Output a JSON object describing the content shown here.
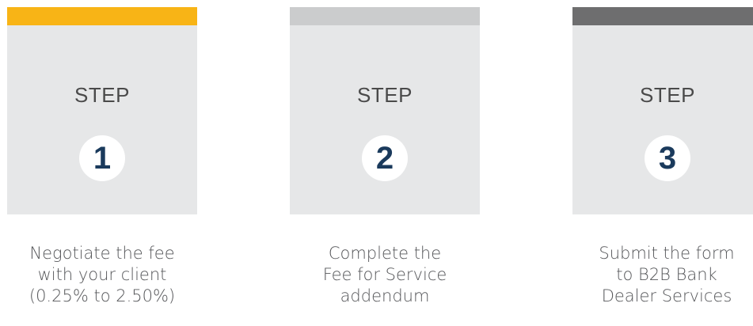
{
  "colors": {
    "card_background": "#e6e7e8",
    "number_text": "#1a3a5c",
    "label_text": "#4a4a4a",
    "description_text": "#56575a"
  },
  "steps": [
    {
      "label": "STEP",
      "number": "1",
      "bar_color": "#f8b416",
      "description_lines": [
        "Negotiate the fee",
        "with your client",
        "(0.25% to 2.50%)"
      ]
    },
    {
      "label": "STEP",
      "number": "2",
      "bar_color": "#cbcccd",
      "description_lines": [
        "Complete the",
        "Fee for Service",
        "addendum"
      ]
    },
    {
      "label": "STEP",
      "number": "3",
      "bar_color": "#6e6e6f",
      "description_lines": [
        "Submit the form",
        "to B2B Bank",
        "Dealer Services"
      ]
    }
  ]
}
